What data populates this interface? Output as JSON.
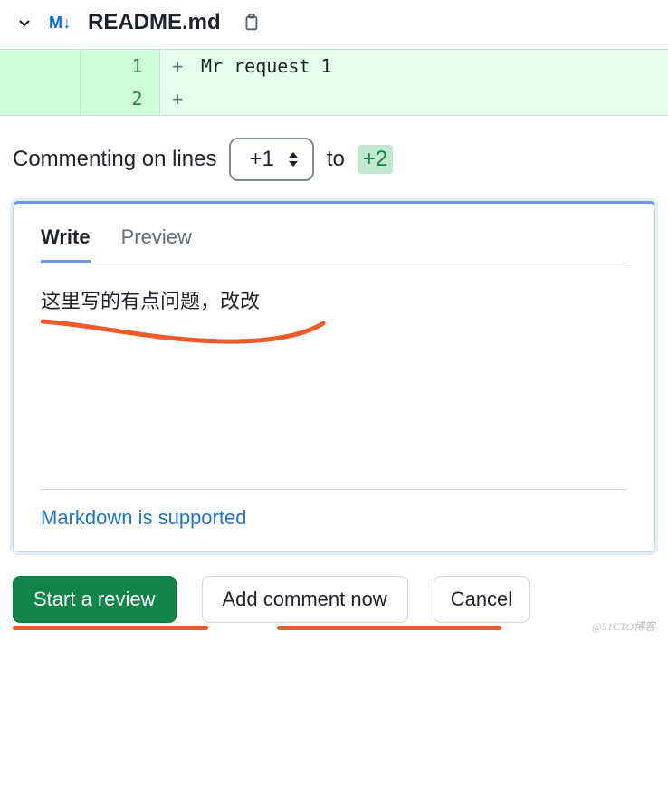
{
  "file": {
    "icon_label": "M↓",
    "name": "README.md"
  },
  "diff": {
    "rows": [
      {
        "old": "",
        "new": "1",
        "marker": "+",
        "content": "Mr request 1"
      },
      {
        "old": "",
        "new": "2",
        "marker": "+",
        "content": ""
      }
    ]
  },
  "commenting": {
    "prefix": "Commenting on lines",
    "from": "+1",
    "to_label": "to",
    "to": "+2"
  },
  "comment": {
    "tabs": {
      "write": "Write",
      "preview": "Preview"
    },
    "text": "这里写的有点问题，改改",
    "markdown_hint": "Markdown is supported"
  },
  "actions": {
    "start_review": "Start a review",
    "add_comment": "Add comment now",
    "cancel": "Cancel"
  },
  "watermark": "@51CTO博客"
}
